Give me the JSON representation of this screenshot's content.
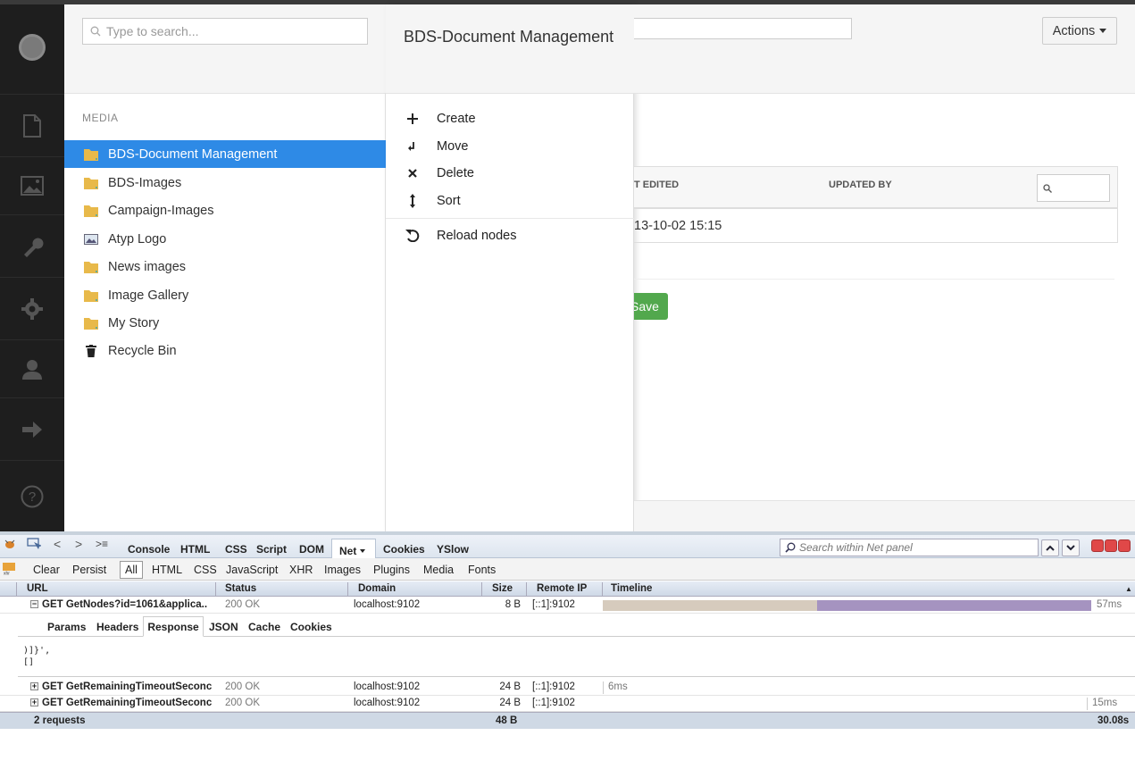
{
  "tree": {
    "search_placeholder": "Type to search...",
    "section_label": "MEDIA",
    "items": [
      {
        "label": "BDS-Document Management",
        "icon": "folder-icon",
        "selected": true
      },
      {
        "label": "BDS-Images",
        "icon": "folder-icon"
      },
      {
        "label": "Campaign-Images",
        "icon": "folder-icon"
      },
      {
        "label": "Atyp Logo",
        "icon": "image-icon"
      },
      {
        "label": "News images",
        "icon": "folder-icon"
      },
      {
        "label": "Image Gallery",
        "icon": "folder-icon"
      },
      {
        "label": "My Story",
        "icon": "folder-icon"
      },
      {
        "label": "Recycle Bin",
        "icon": "trash-icon"
      }
    ]
  },
  "context_menu": {
    "title": "BDS-Document Management",
    "items": [
      "Create",
      "Move",
      "Delete",
      "Sort",
      "Reload nodes"
    ]
  },
  "editor": {
    "actions_label": "Actions",
    "col_last_edited": "T EDITED",
    "col_updated_by": "UPDATED BY",
    "row_date": "13-10-02 15:15",
    "save_label": "Save"
  },
  "firebug": {
    "tabs": [
      "Console",
      "HTML",
      "CSS",
      "Script",
      "DOM",
      "Net",
      "Cookies",
      "YSlow"
    ],
    "search_placeholder": "Search within Net panel",
    "filters": [
      "Clear",
      "Persist",
      "All",
      "HTML",
      "CSS",
      "JavaScript",
      "XHR",
      "Images",
      "Plugins",
      "Media",
      "Fonts"
    ],
    "columns": [
      "URL",
      "Status",
      "Domain",
      "Size",
      "Remote IP",
      "Timeline"
    ],
    "requests": [
      {
        "url": "GET GetNodes?id=1061&applica..",
        "status": "200 OK",
        "domain": "localhost:9102",
        "size": "8 B",
        "ip": "[::1]:9102",
        "time": "57ms",
        "expanded": true
      },
      {
        "url": "GET GetRemainingTimeoutSeconc",
        "status": "200 OK",
        "domain": "localhost:9102",
        "size": "24 B",
        "ip": "[::1]:9102",
        "time": "6ms"
      },
      {
        "url": "GET GetRemainingTimeoutSeconc",
        "status": "200 OK",
        "domain": "localhost:9102",
        "size": "24 B",
        "ip": "[::1]:9102",
        "time": "15ms"
      }
    ],
    "response_tabs": [
      "Params",
      "Headers",
      "Response",
      "JSON",
      "Cache",
      "Cookies"
    ],
    "response_line1": ")]}',",
    "response_line2": "[]",
    "summary_requests": "2 requests",
    "summary_size": "48 B",
    "summary_time": "30.08s"
  },
  "colors": {
    "selected": "#2e8ae6",
    "save": "#52a84d",
    "nav_bg": "#1e1e1e"
  }
}
